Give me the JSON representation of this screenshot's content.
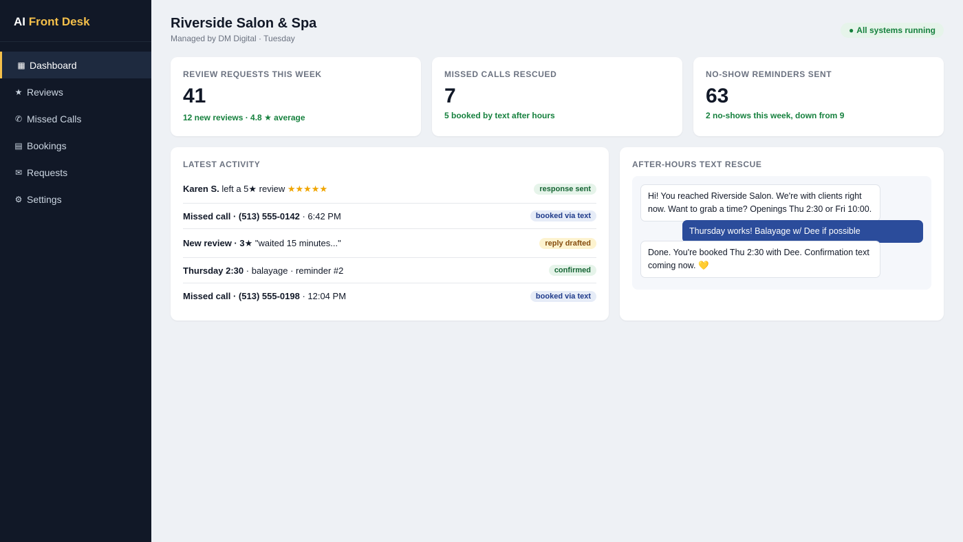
{
  "brand": {
    "prefix": "AI",
    "accent": "Front Desk"
  },
  "sidebar": {
    "items": [
      {
        "icon": "▦",
        "icon_name": "dashboard-icon",
        "label": "Dashboard",
        "active": true
      },
      {
        "icon": "★",
        "icon_name": "star-icon",
        "label": "Reviews"
      },
      {
        "icon": "✆",
        "icon_name": "phone-icon",
        "label": "Missed Calls"
      },
      {
        "icon": "▤",
        "icon_name": "calendar-icon",
        "label": "Bookings"
      },
      {
        "icon": "✉",
        "icon_name": "mail-icon",
        "label": "Requests"
      },
      {
        "icon": "⚙",
        "icon_name": "gear-icon",
        "label": "Settings"
      }
    ]
  },
  "header": {
    "title": "Riverside Salon & Spa",
    "subtitle": "Managed by DM Digital · Tuesday",
    "status": {
      "dot": "●",
      "text": "All systems running"
    }
  },
  "stats": [
    {
      "label": "REVIEW REQUESTS THIS WEEK",
      "value": "41",
      "note": "12 new reviews · 4.8 ★ average"
    },
    {
      "label": "MISSED CALLS RESCUED",
      "value": "7",
      "note": "5 booked by text after hours"
    },
    {
      "label": "NO-SHOW REMINDERS SENT",
      "value": "63",
      "note": "2 no-shows this week, down from 9"
    }
  ],
  "activity": {
    "title": "LATEST ACTIVITY",
    "rows": [
      {
        "bold": "Karen S.",
        "text": " left a 5★ review ",
        "stars": "★★★★★",
        "badge": "response sent",
        "badge_color": "green"
      },
      {
        "bold": "Missed call · (513) 555-0142",
        "text": " · 6:42 PM",
        "stars": "",
        "badge": "booked via text",
        "badge_color": "blue"
      },
      {
        "bold": "New review · 3★",
        "text": " \"waited 15 minutes...\"",
        "stars": "",
        "badge": "reply drafted",
        "badge_color": "yellow"
      },
      {
        "bold": "Thursday 2:30",
        "text": " · balayage · reminder #2",
        "stars": "",
        "badge": "confirmed",
        "badge_color": "green"
      },
      {
        "bold": "Missed call · (513) 555-0198",
        "text": " · 12:04 PM",
        "stars": "",
        "badge": "booked via text",
        "badge_color": "blue"
      }
    ]
  },
  "chat": {
    "title": "AFTER-HOURS TEXT RESCUE",
    "messages": [
      {
        "from": "salon",
        "text": "Hi! You reached Riverside Salon. We're with clients right now. Want to grab a time? Openings Thu 2:30 or Fri 10:00."
      },
      {
        "from": "client",
        "text": "Thursday works! Balayage w/ Dee if possible"
      },
      {
        "from": "salon",
        "text": "Done. You're booked Thu 2:30 with Dee. Confirmation text coming now. 💛"
      }
    ]
  },
  "colors": {
    "sidebar_bg": "#111827",
    "brand_accent": "#f5c04a",
    "page_bg": "#eef1f5",
    "positive_green": "#15803d",
    "outgoing_bubble": "#2b4c9b",
    "star_gold": "#f0a500"
  }
}
